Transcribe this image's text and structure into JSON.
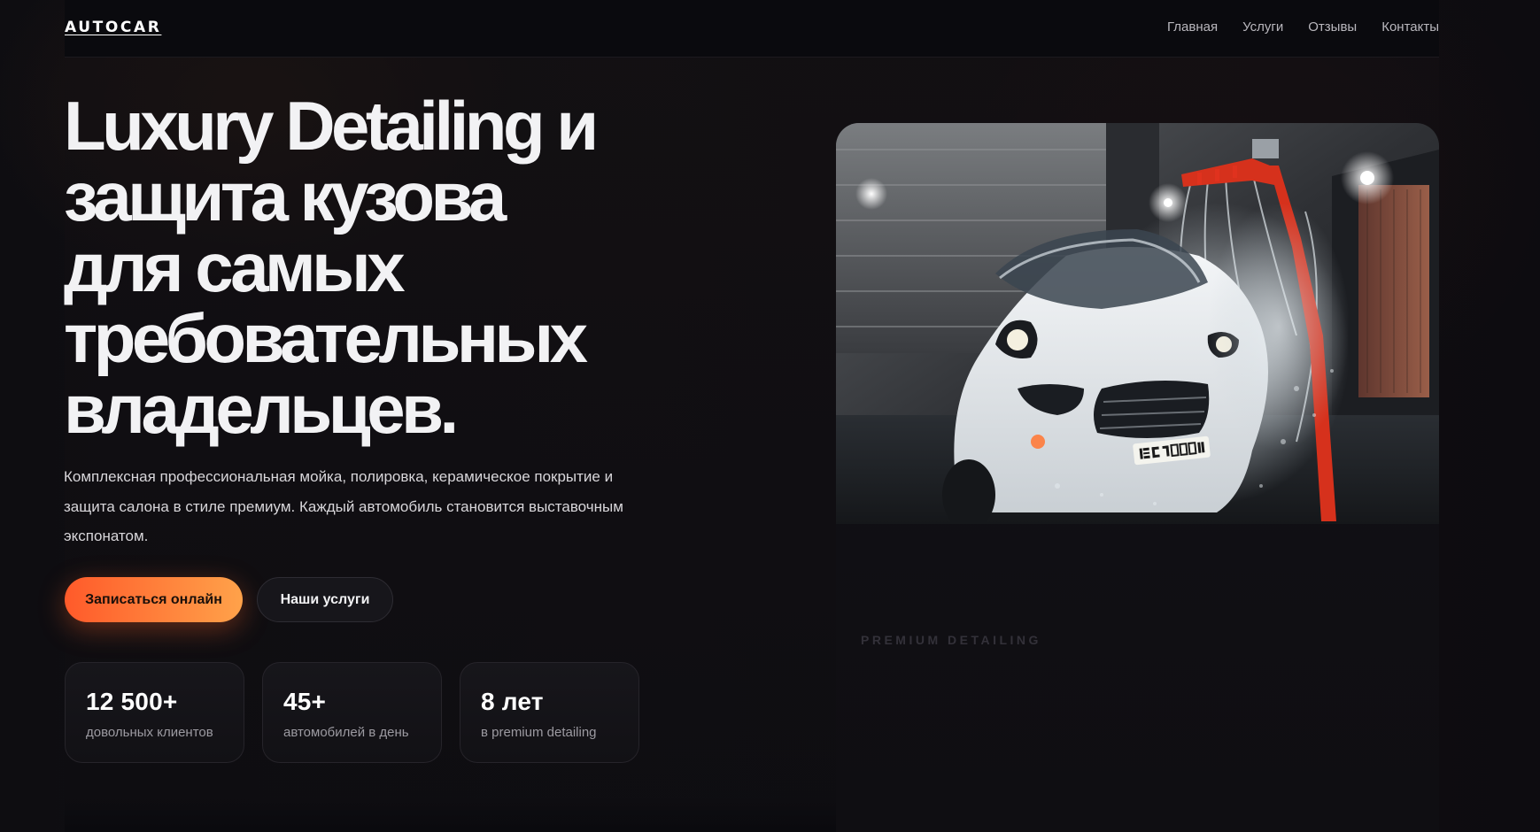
{
  "header": {
    "logo": "AUTOCAR",
    "nav": [
      "Главная",
      "Услуги",
      "Отзывы",
      "Контакты"
    ]
  },
  "hero": {
    "title_lines": [
      "Luxury Detailing и",
      "защита кузова",
      "для самых",
      "требовательных",
      "владельцев."
    ],
    "description": "Комплексная профессиональная мойка, полировка, керамическое покрытие и защита салона в стиле премиум. Каждый автомобиль становится выставочным экспонатом.",
    "primary_button": "Записаться онлайн",
    "secondary_button": "Наши услуги"
  },
  "stats": [
    {
      "value": "12 500+",
      "label": "довольных клиентов"
    },
    {
      "value": "45+",
      "label": "автомобилей в день"
    },
    {
      "value": "8 лет",
      "label": "в premium detailing"
    }
  ],
  "media": {
    "license_plate": "BC 7000 HA",
    "caption": "PREMIUM DETAILING"
  },
  "colors": {
    "accent_start": "#ff5a2a",
    "accent_end": "#ffa24a",
    "background": "#0c0b0f",
    "arch_red": "#e0321e"
  }
}
